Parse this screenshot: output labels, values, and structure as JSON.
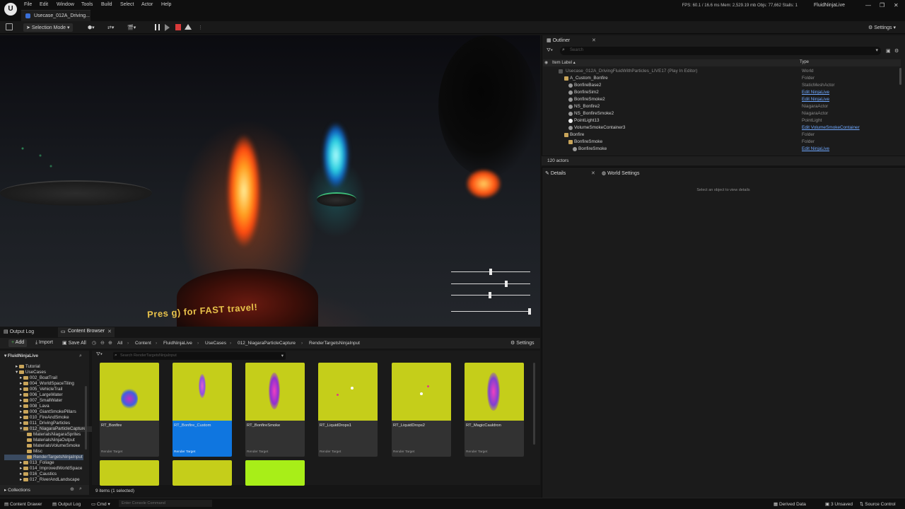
{
  "menubar": {
    "logo": "U",
    "items": [
      "File",
      "Edit",
      "Window",
      "Tools",
      "Build",
      "Select",
      "Actor",
      "Help"
    ],
    "project_tab": "Usecase_012A_Driving...",
    "stats": "FPS: 60.1 / 16.6 ms  Mem: 2,529.19 mb  Objs: 77,662  Stalls: 1",
    "app_name": "FluidNinjaLive"
  },
  "toolbar": {
    "selection_mode": "Selection Mode",
    "settings": "Settings"
  },
  "viewport": {
    "sign_text": "Pres        g) for FAST travel!"
  },
  "outliner": {
    "tab": "Outliner",
    "search_placeholder": "Search",
    "col_label": "Item Label",
    "col_type": "Type",
    "rows": [
      {
        "label": "Usecase_012A_DrivingFluidWithParticles_LIVE17 (Play In Editor)",
        "type": "World",
        "link": false
      },
      {
        "label": "A_Custom_Bonfire",
        "type": "Folder",
        "link": false
      },
      {
        "label": "BonfireBase2",
        "type": "StaticMeshActor",
        "link": false
      },
      {
        "label": "BonfireSim2",
        "type": "Edit NinjaLive",
        "link": true
      },
      {
        "label": "BonfireSmoke2",
        "type": "Edit NinjaLive",
        "link": true
      },
      {
        "label": "NS_Bonfire2",
        "type": "NiagaraActor",
        "link": false
      },
      {
        "label": "NS_BonfireSmoke2",
        "type": "NiagaraActor",
        "link": false
      },
      {
        "label": "PointLight13",
        "type": "PointLight",
        "link": false
      },
      {
        "label": "VolumeSmokeContainer3",
        "type": "Edit VolumeSmokeContainer",
        "link": true
      },
      {
        "label": "Bonfire",
        "type": "Folder",
        "link": false
      },
      {
        "label": "BonfireSmoke",
        "type": "Folder",
        "link": false
      },
      {
        "label": "BonfireSmoke",
        "type": "Edit NinjaLive",
        "link": true
      }
    ],
    "actors_count": "120 actors"
  },
  "details": {
    "tab": "Details",
    "world_settings_tab": "World Settings",
    "empty_text": "Select an object to view details"
  },
  "bottom": {
    "output_log_tab": "Output Log",
    "content_browser_tab": "Content Browser",
    "add": "Add",
    "import": "Import",
    "save_all": "Save All",
    "breadcrumb": [
      "All",
      "Content",
      "FluidNinjaLive",
      "UseCases",
      "012_NiagaraParticleCapture",
      "RenderTargetsNinjaInput"
    ],
    "settings": "Settings",
    "filter_placeholder": "Search RenderTargetsNinjaInput",
    "tree_root": "FluidNinjaLive",
    "tree": [
      "Tutorial",
      "UseCases",
      "002_BoatTrail",
      "004_WorldSpaceTiling",
      "005_VehicleTrail",
      "006_LargeWater",
      "007_SmallWater",
      "008_Lava",
      "009_GiantSmokePillars",
      "010_FireAndSmoke",
      "011_DrivingParticles",
      "012_NiagaraParticleCapture",
      "MaterialsNiagaraSprites",
      "MaterialsNinjaOutput",
      "MaterialsVolumeSmoke",
      "Misc",
      "RenderTargetsNinjaInput",
      "013_Foliage",
      "014_ImprovedWorldSpace",
      "016_Caustics",
      "017_RiverAndLandscape"
    ],
    "collections": "Collections",
    "assets": [
      {
        "name": "RT_Bonfire",
        "kind": "Render Target"
      },
      {
        "name": "RT_Bonfire_Custom",
        "kind": "Render Target"
      },
      {
        "name": "RT_BonfireSmoke",
        "kind": "Render Target"
      },
      {
        "name": "RT_LiquidDrops1",
        "kind": "Render Target"
      },
      {
        "name": "RT_LiquidDrops2",
        "kind": "Render Target"
      },
      {
        "name": "RT_MagicCauldron",
        "kind": "Render Target"
      }
    ],
    "selected_asset": "RT_Bonfire_Custom",
    "items_count": "9 items (1 selected)"
  },
  "statusbar": {
    "content_drawer": "Content Drawer",
    "output_log": "Output Log",
    "cmd": "Cmd",
    "console_placeholder": "Enter Console Command",
    "derived_data": "Derived Data",
    "unsaved": "3 Unsaved",
    "source_control": "Source Control"
  },
  "colors": {
    "accent": "#0f76e0",
    "thumb": "#c5ce1a",
    "link": "#6fa8ff"
  }
}
